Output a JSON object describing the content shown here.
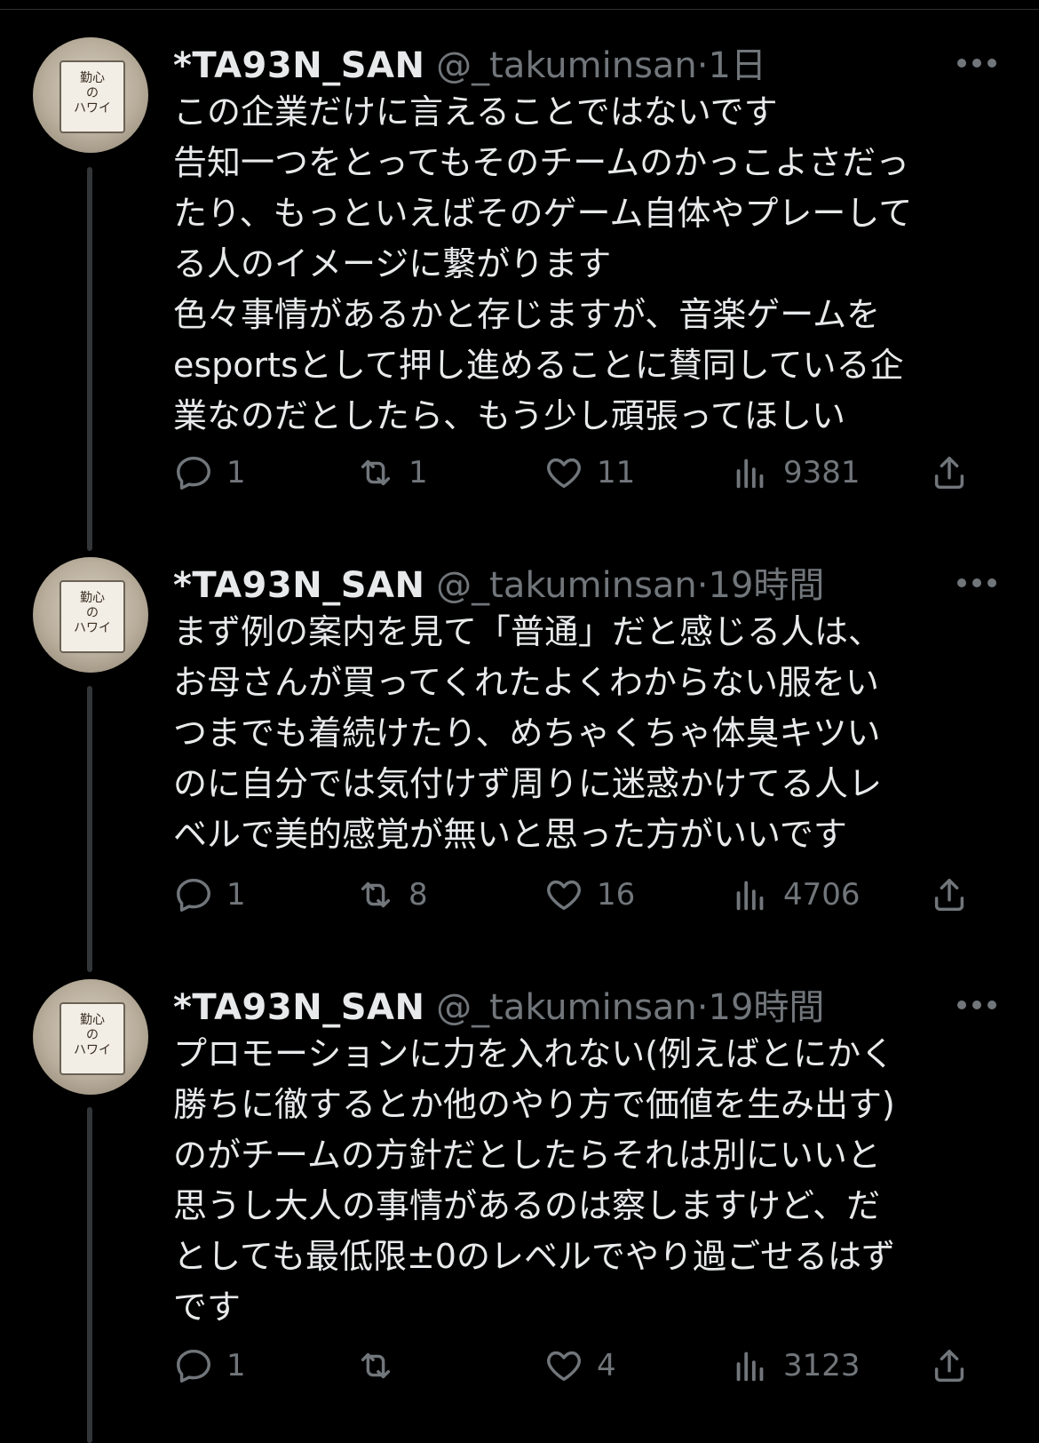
{
  "tweets": [
    {
      "name": "*TA93N_SAN",
      "handle": "@_takuminsan",
      "separator": "·",
      "time": "1日",
      "avatar_text": "勤心\nの\nハワイ",
      "lines": [
        "この企業だけに言えることではないです",
        "告知一つをとってもそのチームのかっこよさだっ",
        "たり、もっといえばそのゲーム自体やプレーして",
        "る人のイメージに繋がります",
        "色々事情があるかと存じますが、音楽ゲームを",
        "esportsとして押し進めることに賛同している企",
        "業なのだとしたら、もう少し頑張ってほしい"
      ],
      "replies": "1",
      "retweets": "1",
      "likes": "11",
      "views": "9381"
    },
    {
      "name": "*TA93N_SAN",
      "handle": "@_takuminsan",
      "separator": "·",
      "time": "19時間",
      "avatar_text": "勤心\nの\nハワイ",
      "lines": [
        "まず例の案内を見て「普通」だと感じる人は、",
        "お母さんが買ってくれたよくわからない服をい",
        "つまでも着続けたり、めちゃくちゃ体臭キツい",
        "のに自分では気付けず周りに迷惑かけてる人レ",
        "ベルで美的感覚が無いと思った方がいいです"
      ],
      "replies": "1",
      "retweets": "8",
      "likes": "16",
      "views": "4706"
    },
    {
      "name": "*TA93N_SAN",
      "handle": "@_takuminsan",
      "separator": "·",
      "time": "19時間",
      "avatar_text": "勤心\nの\nハワイ",
      "lines": [
        "プロモーションに力を入れない(例えばとにかく",
        "勝ちに徹するとか他のやり方で価値を生み出す)",
        "のがチームの方針だとしたらそれは別にいいと",
        "思うし大人の事情があるのは察しますけど、だ",
        "としても最低限±0のレベルでやり過ごせるはず",
        "です"
      ],
      "replies": "1",
      "retweets": "",
      "likes": "4",
      "views": "3123"
    }
  ],
  "icons": {
    "reply": "reply-icon",
    "retweet": "retweet-icon",
    "like": "heart-icon",
    "views": "views-icon",
    "share": "share-icon",
    "more": "more-icon"
  },
  "colors": {
    "background": "#000000",
    "text": "#e7e9ea",
    "secondary": "#71767b",
    "thread_line": "#333639"
  }
}
